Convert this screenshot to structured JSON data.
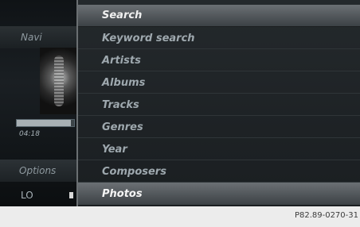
{
  "left": {
    "navi_label": "Navi",
    "time": "04:18",
    "options_label": "Options",
    "lo_label": "LO",
    "progress": 0.95
  },
  "menu": {
    "header": "Search",
    "items": [
      "Keyword search",
      "Artists",
      "Albums",
      "Tracks",
      "Genres",
      "Year",
      "Composers",
      "Photos"
    ],
    "selected_index": 7
  },
  "image_code": "P82.89-0270-31"
}
